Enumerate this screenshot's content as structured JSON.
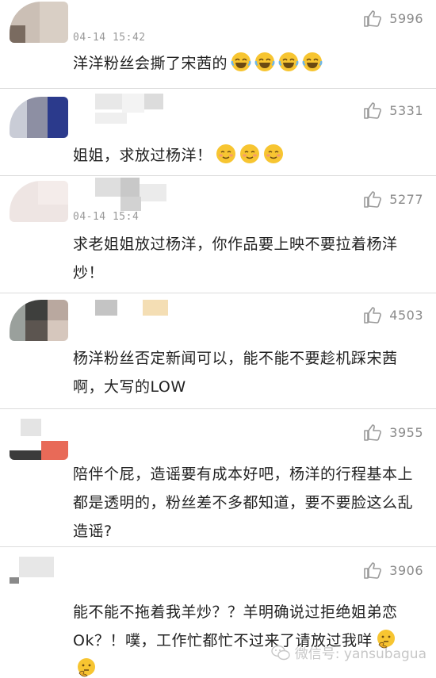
{
  "comments": [
    {
      "time": "04-14 15:42",
      "likes": "5996",
      "text": "洋洋粉丝会撕了宋茜的",
      "emoji": "laughing-crying-emoji",
      "emoji_count": 4
    },
    {
      "time": "",
      "likes": "5331",
      "text": "姐姐，求放过杨洋！",
      "emoji": "smiling-blush-emoji",
      "emoji_count": 3
    },
    {
      "time": "04-14 15:4",
      "likes": "5277",
      "text": "求老姐姐放过杨洋，你作品要上映不要拉着杨洋炒！",
      "emoji": "",
      "emoji_count": 0
    },
    {
      "time": "",
      "likes": "4503",
      "text": "杨洋粉丝否定新闻可以，能不能不要趁机踩宋茜啊，大写的LOW",
      "emoji": "",
      "emoji_count": 0
    },
    {
      "time": "",
      "likes": "3955",
      "text": "陪伴个屁，造谣要有成本好吧，杨洋的行程基本上都是透明的，粉丝差不多都知道，要不要脸这么乱造谣?",
      "emoji": "",
      "emoji_count": 0
    },
    {
      "time": "",
      "likes": "3906",
      "text": "能不能不拖着我羊炒？？羊明确说过拒绝姐弟恋Ok？！噗，工作忙都忙不过来了请放过我咩",
      "emoji": "thinking-emoji",
      "emoji_count": 2
    }
  ],
  "watermark": {
    "text": "微信号: yansubagua",
    "icon": "wechat-icon"
  },
  "colors": {
    "text": "#222222",
    "meta": "#999999",
    "like": "#8a8a8a",
    "divider": "#dcdcdc",
    "emoji": "#f7c531"
  }
}
